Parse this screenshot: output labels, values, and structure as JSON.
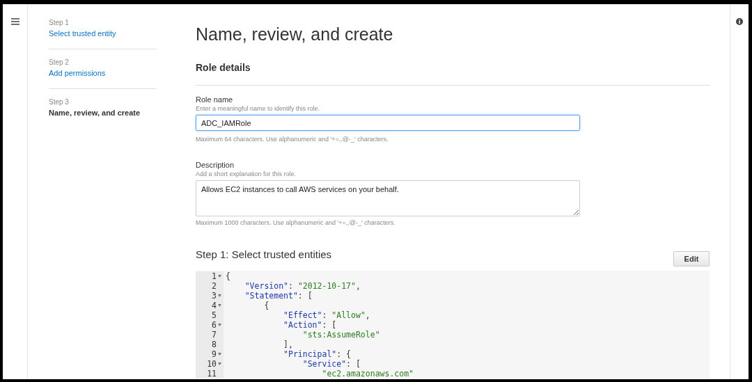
{
  "steps": [
    {
      "number": "Step 1",
      "label": "Select trusted entity",
      "selected": false
    },
    {
      "number": "Step 2",
      "label": "Add permissions",
      "selected": false
    },
    {
      "number": "Step 3",
      "label": "Name, review, and create",
      "selected": true
    }
  ],
  "title": "Name, review, and create",
  "section_title": "Role details",
  "role_name": {
    "label": "Role name",
    "hint": "Enter a meaningful name to identify this role.",
    "value": "ADC_IAMRole",
    "help": "Maximum 64 characters. Use alphanumeric and '+=,.@-_' characters."
  },
  "description": {
    "label": "Description",
    "hint": "Add a short explanation for this role.",
    "value": "Allows EC2 instances to call AWS services on your behalf.",
    "help": "Maximum 1000 characters. Use alphanumeric and '+=,.@-_' characters."
  },
  "trust_section": {
    "title": "Step 1: Select trusted entities",
    "edit_button": "Edit"
  },
  "code": [
    {
      "number": "1",
      "foldable": true,
      "tokens": [
        {
          "kind": "punct",
          "text": "{"
        }
      ]
    },
    {
      "number": "2",
      "foldable": false,
      "tokens": [
        {
          "kind": "key",
          "text": "    \"Version\""
        },
        {
          "kind": "punct",
          "text": ": "
        },
        {
          "kind": "string",
          "text": "\"2012-10-17\""
        },
        {
          "kind": "punct",
          "text": ","
        }
      ]
    },
    {
      "number": "3",
      "foldable": true,
      "tokens": [
        {
          "kind": "key",
          "text": "    \"Statement\""
        },
        {
          "kind": "punct",
          "text": ": ["
        }
      ]
    },
    {
      "number": "4",
      "foldable": true,
      "tokens": [
        {
          "kind": "punct",
          "text": "        {"
        }
      ]
    },
    {
      "number": "5",
      "foldable": false,
      "tokens": [
        {
          "kind": "key",
          "text": "            \"Effect\""
        },
        {
          "kind": "punct",
          "text": ": "
        },
        {
          "kind": "string",
          "text": "\"Allow\""
        },
        {
          "kind": "punct",
          "text": ","
        }
      ]
    },
    {
      "number": "6",
      "foldable": true,
      "tokens": [
        {
          "kind": "key",
          "text": "            \"Action\""
        },
        {
          "kind": "punct",
          "text": ": ["
        }
      ]
    },
    {
      "number": "7",
      "foldable": false,
      "tokens": [
        {
          "kind": "string",
          "text": "                \"sts:AssumeRole\""
        }
      ]
    },
    {
      "number": "8",
      "foldable": false,
      "tokens": [
        {
          "kind": "punct",
          "text": "            ],"
        }
      ]
    },
    {
      "number": "9",
      "foldable": true,
      "tokens": [
        {
          "kind": "key",
          "text": "            \"Principal\""
        },
        {
          "kind": "punct",
          "text": ": {"
        }
      ]
    },
    {
      "number": "10",
      "foldable": true,
      "tokens": [
        {
          "kind": "key",
          "text": "                \"Service\""
        },
        {
          "kind": "punct",
          "text": ": ["
        }
      ]
    },
    {
      "number": "11",
      "foldable": false,
      "tokens": [
        {
          "kind": "string",
          "text": "                    \"ec2.amazonaws.com\""
        }
      ]
    }
  ]
}
